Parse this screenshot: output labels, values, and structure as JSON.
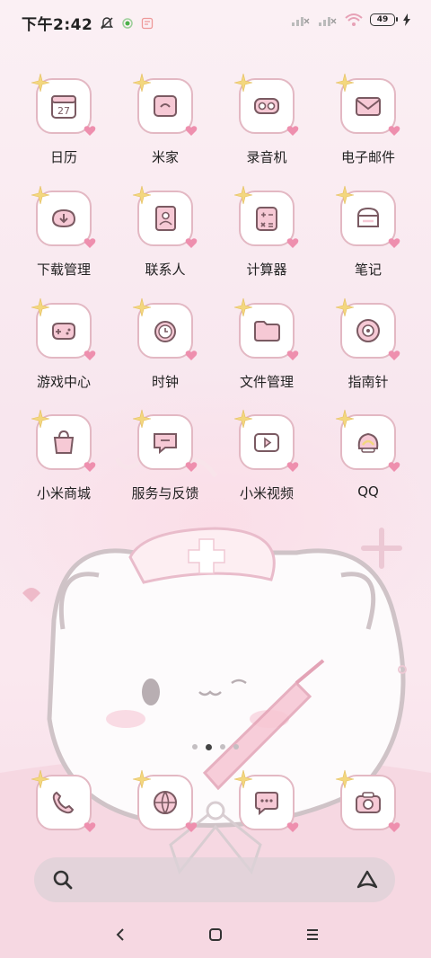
{
  "status_bar": {
    "time": "下午2:42",
    "battery_level": "49",
    "icons": [
      "mute-icon",
      "location-dot-icon",
      "nfc-icon",
      "signal-icon",
      "signal-icon",
      "wifi-icon",
      "battery-icon",
      "charging-icon"
    ]
  },
  "colors": {
    "tile_border": "#e3b8c3",
    "heart": "#ee8fae",
    "sparkle": "#f3d77f",
    "glyph_outline": "#7a5a62",
    "glyph_fill": "#f6c9d5"
  },
  "apps": [
    {
      "label": "日历",
      "icon": "calendar-icon",
      "day": "27"
    },
    {
      "label": "米家",
      "icon": "home-icon"
    },
    {
      "label": "录音机",
      "icon": "recorder-icon"
    },
    {
      "label": "电子邮件",
      "icon": "mail-icon"
    },
    {
      "label": "下载管理",
      "icon": "download-icon"
    },
    {
      "label": "联系人",
      "icon": "contacts-icon"
    },
    {
      "label": "计算器",
      "icon": "calculator-icon"
    },
    {
      "label": "笔记",
      "icon": "notes-icon"
    },
    {
      "label": "游戏中心",
      "icon": "gamepad-icon"
    },
    {
      "label": "时钟",
      "icon": "clock-icon"
    },
    {
      "label": "文件管理",
      "icon": "folder-icon"
    },
    {
      "label": "指南针",
      "icon": "compass-icon"
    },
    {
      "label": "小米商城",
      "icon": "shop-bag-icon"
    },
    {
      "label": "服务与反馈",
      "icon": "feedback-icon"
    },
    {
      "label": "小米视频",
      "icon": "video-icon"
    },
    {
      "label": "QQ",
      "icon": "qq-icon"
    }
  ],
  "dock": [
    {
      "icon": "phone-icon"
    },
    {
      "icon": "browser-icon"
    },
    {
      "icon": "messages-icon"
    },
    {
      "icon": "camera-icon"
    }
  ],
  "page_indicator": {
    "pages": 4,
    "current": 2
  },
  "search": {
    "icon": "search-icon",
    "assistant_icon": "assistant-icon"
  },
  "nav": [
    "back-icon",
    "home-square-icon",
    "menu-icon"
  ]
}
